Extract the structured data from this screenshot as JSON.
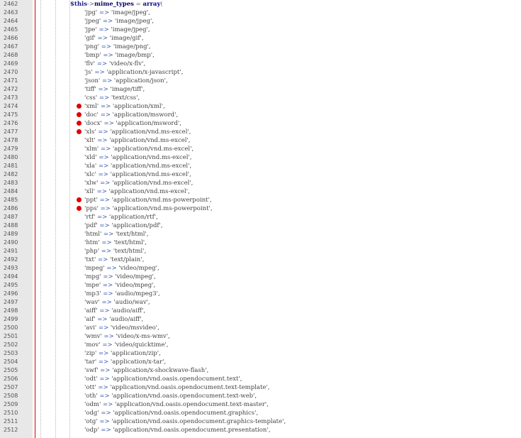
{
  "editor": {
    "first_line": {
      "number": "2462",
      "variable": "$this",
      "arrow": "->",
      "property": "mime_types",
      "assign": " = ",
      "keyword": "array",
      "open": "("
    },
    "entries": [
      {
        "ln": "2463",
        "key": "'jpg'",
        "value": "'image/jpeg'",
        "bp": false
      },
      {
        "ln": "2464",
        "key": "'jpeg'",
        "value": "'image/jpeg'",
        "bp": false
      },
      {
        "ln": "2465",
        "key": "'jpe'",
        "value": "'image/jpeg'",
        "bp": false
      },
      {
        "ln": "2466",
        "key": "'gif'",
        "value": "'image/gif'",
        "bp": false
      },
      {
        "ln": "2467",
        "key": "'png'",
        "value": "'image/png'",
        "bp": false
      },
      {
        "ln": "2468",
        "key": "'bmp'",
        "value": "'image/bmp'",
        "bp": false
      },
      {
        "ln": "2469",
        "key": "'flv'",
        "value": "'video/x-flv'",
        "bp": false
      },
      {
        "ln": "2470",
        "key": "'js'",
        "value": "'application/x-javascript'",
        "bp": false
      },
      {
        "ln": "2471",
        "key": "'json'",
        "value": "'application/json'",
        "bp": false
      },
      {
        "ln": "2472",
        "key": "'tiff'",
        "value": "'image/tiff'",
        "bp": false
      },
      {
        "ln": "2473",
        "key": "'css'",
        "value": "'text/css'",
        "bp": false
      },
      {
        "ln": "2474",
        "key": "'xml'",
        "value": "'application/xml'",
        "bp": true
      },
      {
        "ln": "2475",
        "key": "'doc'",
        "value": "'application/msword'",
        "bp": true
      },
      {
        "ln": "2476",
        "key": "'docx'",
        "value": "'application/msword'",
        "bp": true
      },
      {
        "ln": "2477",
        "key": "'xls'",
        "value": "'application/vnd.ms-excel'",
        "bp": true
      },
      {
        "ln": "2478",
        "key": "'xlt'",
        "value": "'application/vnd.ms-excel'",
        "bp": false
      },
      {
        "ln": "2479",
        "key": "'xlm'",
        "value": "'application/vnd.ms-excel'",
        "bp": false
      },
      {
        "ln": "2480",
        "key": "'xld'",
        "value": "'application/vnd.ms-excel'",
        "bp": false
      },
      {
        "ln": "2481",
        "key": "'xla'",
        "value": "'application/vnd.ms-excel'",
        "bp": false
      },
      {
        "ln": "2482",
        "key": "'xlc'",
        "value": "'application/vnd.ms-excel'",
        "bp": false
      },
      {
        "ln": "2483",
        "key": "'xlw'",
        "value": "'application/vnd.ms-excel'",
        "bp": false
      },
      {
        "ln": "2484",
        "key": "'xll'",
        "value": "'application/vnd.ms-excel'",
        "bp": false
      },
      {
        "ln": "2485",
        "key": "'ppt'",
        "value": "'application/vnd.ms-powerpoint'",
        "bp": true
      },
      {
        "ln": "2486",
        "key": "'pps'",
        "value": "'application/vnd.ms-powerpoint'",
        "bp": true
      },
      {
        "ln": "2487",
        "key": "'rtf'",
        "value": "'application/rtf'",
        "bp": false
      },
      {
        "ln": "2488",
        "key": "'pdf'",
        "value": "'application/pdf'",
        "bp": false
      },
      {
        "ln": "2489",
        "key": "'html'",
        "value": "'text/html'",
        "bp": false
      },
      {
        "ln": "2490",
        "key": "'htm'",
        "value": "'text/html'",
        "bp": false
      },
      {
        "ln": "2491",
        "key": "'php'",
        "value": "'text/html'",
        "bp": false
      },
      {
        "ln": "2492",
        "key": "'txt'",
        "value": "'text/plain'",
        "bp": false
      },
      {
        "ln": "2493",
        "key": "'mpeg'",
        "value": "'video/mpeg'",
        "bp": false
      },
      {
        "ln": "2494",
        "key": "'mpg'",
        "value": "'video/mpeg'",
        "bp": false
      },
      {
        "ln": "2495",
        "key": "'mpe'",
        "value": "'video/mpeg'",
        "bp": false
      },
      {
        "ln": "2496",
        "key": "'mp3'",
        "value": "'audio/mpeg3'",
        "bp": false
      },
      {
        "ln": "2497",
        "key": "'wav'",
        "value": "'audio/wav'",
        "bp": false
      },
      {
        "ln": "2498",
        "key": "'aiff'",
        "value": "'audio/aiff'",
        "bp": false
      },
      {
        "ln": "2499",
        "key": "'aif'",
        "value": "'audio/aiff'",
        "bp": false
      },
      {
        "ln": "2500",
        "key": "'avi'",
        "value": "'video/msvideo'",
        "bp": false
      },
      {
        "ln": "2501",
        "key": "'wmv'",
        "value": "'video/x-ms-wmv'",
        "bp": false
      },
      {
        "ln": "2502",
        "key": "'mov'",
        "value": "'video/quicktime'",
        "bp": false
      },
      {
        "ln": "2503",
        "key": "'zip'",
        "value": "'application/zip'",
        "bp": false
      },
      {
        "ln": "2504",
        "key": "'tar'",
        "value": "'application/x-tar'",
        "bp": false
      },
      {
        "ln": "2505",
        "key": "'swf'",
        "value": "'application/x-shockwave-flash'",
        "bp": false
      },
      {
        "ln": "2506",
        "key": "'odt'",
        "value": "'application/vnd.oasis.opendocument.text'",
        "bp": false
      },
      {
        "ln": "2507",
        "key": "'ott'",
        "value": "'application/vnd.oasis.opendocument.text-template'",
        "bp": false
      },
      {
        "ln": "2508",
        "key": "'oth'",
        "value": "'application/vnd.oasis.opendocument.text-web'",
        "bp": false
      },
      {
        "ln": "2509",
        "key": "'odm'",
        "value": "'application/vnd.oasis.opendocument.text-master'",
        "bp": false
      },
      {
        "ln": "2510",
        "key": "'odg'",
        "value": "'application/vnd.oasis.opendocument.graphics'",
        "bp": false
      },
      {
        "ln": "2511",
        "key": "'otg'",
        "value": "'application/vnd.oasis.opendocument.graphics-template'",
        "bp": false
      },
      {
        "ln": "2512",
        "key": "'odp'",
        "value": "'application/vnd.oasis.opendocument.presentation'",
        "bp": false
      }
    ],
    "arrow_token": " => ",
    "separator": ",",
    "colors": {
      "gutter": "#e8e8e8",
      "margin_line": "#d40000",
      "breakpoint": "#e00000"
    },
    "breakpoint_icon": "breakpoint-dot-icon"
  }
}
